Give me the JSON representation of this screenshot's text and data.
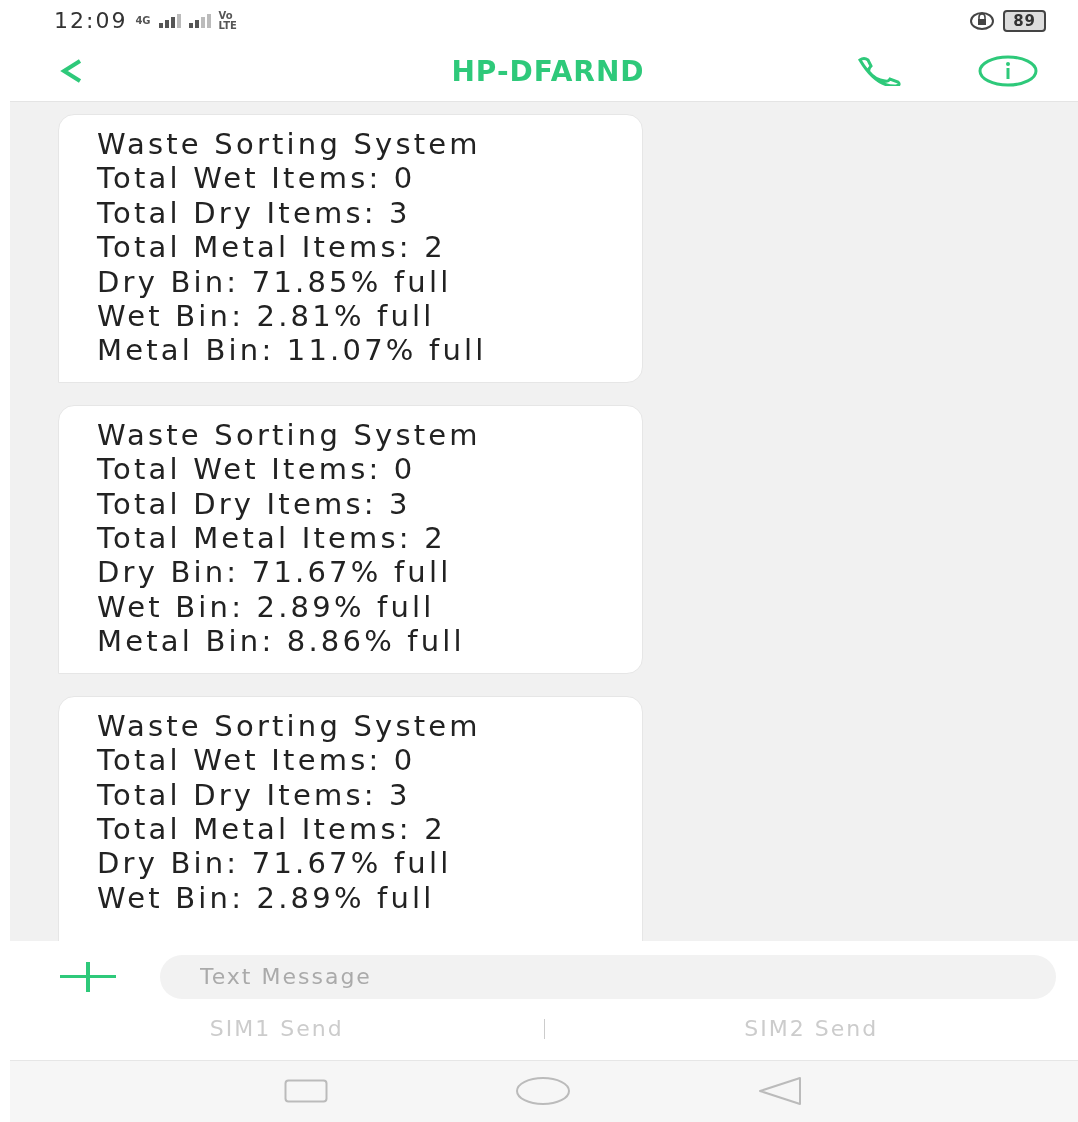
{
  "status_bar": {
    "time": "12:09",
    "network": "4G",
    "volte": "Vo LTE",
    "battery": "89"
  },
  "header": {
    "title": "HP-DFARND"
  },
  "messages": [
    {
      "lines": [
        "Waste Sorting System",
        "Total Wet Items: 0",
        "Total Dry Items: 3",
        "Total Metal Items: 2",
        "Dry Bin: 71.85% full",
        "Wet Bin: 2.81% full",
        "Metal Bin: 11.07% full"
      ]
    },
    {
      "lines": [
        "Waste Sorting System",
        "Total Wet Items: 0",
        "Total Dry Items: 3",
        "Total Metal Items: 2",
        "Dry Bin: 71.67% full",
        "Wet Bin: 2.89% full",
        "Metal Bin: 8.86% full"
      ]
    },
    {
      "lines": [
        "Waste Sorting System",
        "Total Wet Items: 0",
        "Total Dry Items: 3",
        "Total Metal Items: 2",
        "Dry Bin: 71.67% full",
        "Wet Bin: 2.89% full"
      ]
    }
  ],
  "composer": {
    "placeholder": "Text Message",
    "send_buttons": [
      "SIM1 Send",
      "SIM2 Send"
    ]
  }
}
